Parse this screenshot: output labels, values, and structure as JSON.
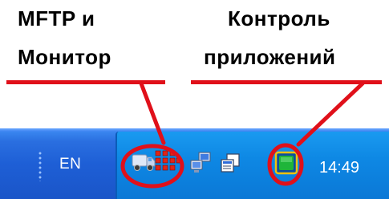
{
  "annotations": {
    "left_label_line1": "MFTP и",
    "left_label_line2": "Монитор",
    "right_label_line1": "Контроль",
    "right_label_line2": "приложений"
  },
  "taskbar": {
    "language_indicator": "EN",
    "clock": "14:49",
    "tray_icons": [
      {
        "name": "mftp-truck-icon"
      },
      {
        "name": "monitor-grid-icon"
      },
      {
        "name": "network-icon"
      },
      {
        "name": "copy-windows-icon"
      },
      {
        "name": "app-control-icon"
      }
    ]
  },
  "colors": {
    "annotation_red": "#e0101a",
    "taskbar_blue": "#1e5fd6",
    "tray_blue": "#0e88e4",
    "app_control_green": "#1fb53a"
  }
}
